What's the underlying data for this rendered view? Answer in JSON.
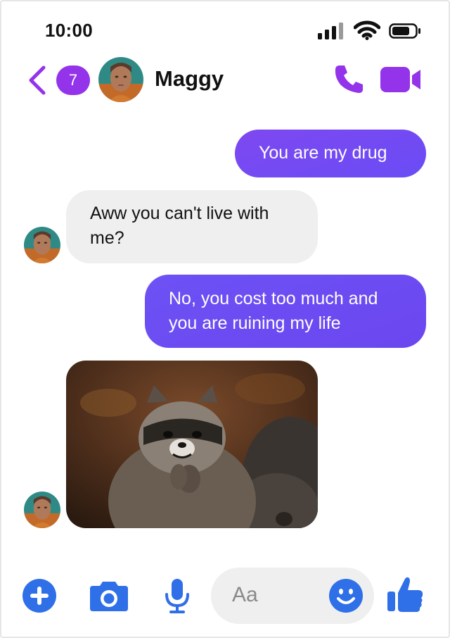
{
  "status_bar": {
    "time": "10:00"
  },
  "header": {
    "unread_count": "7",
    "contact_name": "Maggy"
  },
  "messages": [
    {
      "direction": "outgoing",
      "text": "You are my drug"
    },
    {
      "direction": "incoming",
      "text": "Aww you can't live with me?"
    },
    {
      "direction": "outgoing",
      "text": "No, you cost too much and you are ruining my life"
    },
    {
      "direction": "incoming",
      "type": "image",
      "subject": "raccoon"
    }
  ],
  "composer": {
    "placeholder": "Aa"
  },
  "icons": {
    "back": "chevron-left-icon",
    "call": "phone-icon",
    "video": "video-camera-icon",
    "plus": "plus-circle-icon",
    "camera": "camera-icon",
    "mic": "microphone-icon",
    "emoji": "smiley-icon",
    "like": "thumbs-up-icon"
  },
  "colors": {
    "accent_purple": "#9333ea",
    "outgoing_bubble": "#7048f2",
    "incoming_bubble": "#efefef",
    "composer_blue": "#2f6fe8"
  }
}
